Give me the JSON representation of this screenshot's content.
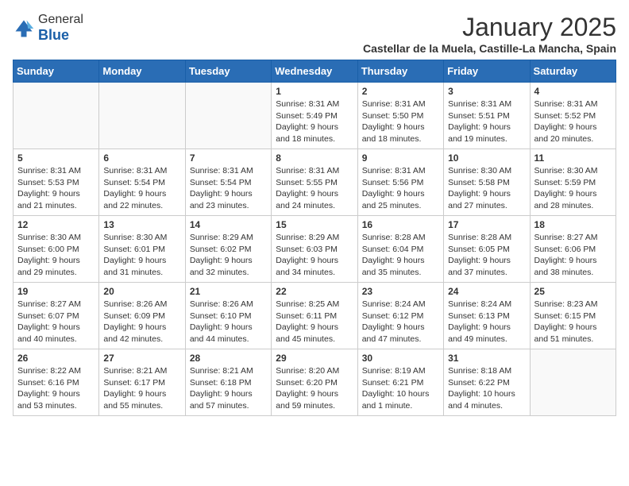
{
  "header": {
    "logo_general": "General",
    "logo_blue": "Blue",
    "title": "January 2025",
    "subtitle": "Castellar de la Muela, Castille-La Mancha, Spain"
  },
  "calendar": {
    "days_of_week": [
      "Sunday",
      "Monday",
      "Tuesday",
      "Wednesday",
      "Thursday",
      "Friday",
      "Saturday"
    ],
    "weeks": [
      [
        {
          "day": "",
          "info": ""
        },
        {
          "day": "",
          "info": ""
        },
        {
          "day": "",
          "info": ""
        },
        {
          "day": "1",
          "info": "Sunrise: 8:31 AM\nSunset: 5:49 PM\nDaylight: 9 hours and 18 minutes."
        },
        {
          "day": "2",
          "info": "Sunrise: 8:31 AM\nSunset: 5:50 PM\nDaylight: 9 hours and 18 minutes."
        },
        {
          "day": "3",
          "info": "Sunrise: 8:31 AM\nSunset: 5:51 PM\nDaylight: 9 hours and 19 minutes."
        },
        {
          "day": "4",
          "info": "Sunrise: 8:31 AM\nSunset: 5:52 PM\nDaylight: 9 hours and 20 minutes."
        }
      ],
      [
        {
          "day": "5",
          "info": "Sunrise: 8:31 AM\nSunset: 5:53 PM\nDaylight: 9 hours and 21 minutes."
        },
        {
          "day": "6",
          "info": "Sunrise: 8:31 AM\nSunset: 5:54 PM\nDaylight: 9 hours and 22 minutes."
        },
        {
          "day": "7",
          "info": "Sunrise: 8:31 AM\nSunset: 5:54 PM\nDaylight: 9 hours and 23 minutes."
        },
        {
          "day": "8",
          "info": "Sunrise: 8:31 AM\nSunset: 5:55 PM\nDaylight: 9 hours and 24 minutes."
        },
        {
          "day": "9",
          "info": "Sunrise: 8:31 AM\nSunset: 5:56 PM\nDaylight: 9 hours and 25 minutes."
        },
        {
          "day": "10",
          "info": "Sunrise: 8:30 AM\nSunset: 5:58 PM\nDaylight: 9 hours and 27 minutes."
        },
        {
          "day": "11",
          "info": "Sunrise: 8:30 AM\nSunset: 5:59 PM\nDaylight: 9 hours and 28 minutes."
        }
      ],
      [
        {
          "day": "12",
          "info": "Sunrise: 8:30 AM\nSunset: 6:00 PM\nDaylight: 9 hours and 29 minutes."
        },
        {
          "day": "13",
          "info": "Sunrise: 8:30 AM\nSunset: 6:01 PM\nDaylight: 9 hours and 31 minutes."
        },
        {
          "day": "14",
          "info": "Sunrise: 8:29 AM\nSunset: 6:02 PM\nDaylight: 9 hours and 32 minutes."
        },
        {
          "day": "15",
          "info": "Sunrise: 8:29 AM\nSunset: 6:03 PM\nDaylight: 9 hours and 34 minutes."
        },
        {
          "day": "16",
          "info": "Sunrise: 8:28 AM\nSunset: 6:04 PM\nDaylight: 9 hours and 35 minutes."
        },
        {
          "day": "17",
          "info": "Sunrise: 8:28 AM\nSunset: 6:05 PM\nDaylight: 9 hours and 37 minutes."
        },
        {
          "day": "18",
          "info": "Sunrise: 8:27 AM\nSunset: 6:06 PM\nDaylight: 9 hours and 38 minutes."
        }
      ],
      [
        {
          "day": "19",
          "info": "Sunrise: 8:27 AM\nSunset: 6:07 PM\nDaylight: 9 hours and 40 minutes."
        },
        {
          "day": "20",
          "info": "Sunrise: 8:26 AM\nSunset: 6:09 PM\nDaylight: 9 hours and 42 minutes."
        },
        {
          "day": "21",
          "info": "Sunrise: 8:26 AM\nSunset: 6:10 PM\nDaylight: 9 hours and 44 minutes."
        },
        {
          "day": "22",
          "info": "Sunrise: 8:25 AM\nSunset: 6:11 PM\nDaylight: 9 hours and 45 minutes."
        },
        {
          "day": "23",
          "info": "Sunrise: 8:24 AM\nSunset: 6:12 PM\nDaylight: 9 hours and 47 minutes."
        },
        {
          "day": "24",
          "info": "Sunrise: 8:24 AM\nSunset: 6:13 PM\nDaylight: 9 hours and 49 minutes."
        },
        {
          "day": "25",
          "info": "Sunrise: 8:23 AM\nSunset: 6:15 PM\nDaylight: 9 hours and 51 minutes."
        }
      ],
      [
        {
          "day": "26",
          "info": "Sunrise: 8:22 AM\nSunset: 6:16 PM\nDaylight: 9 hours and 53 minutes."
        },
        {
          "day": "27",
          "info": "Sunrise: 8:21 AM\nSunset: 6:17 PM\nDaylight: 9 hours and 55 minutes."
        },
        {
          "day": "28",
          "info": "Sunrise: 8:21 AM\nSunset: 6:18 PM\nDaylight: 9 hours and 57 minutes."
        },
        {
          "day": "29",
          "info": "Sunrise: 8:20 AM\nSunset: 6:20 PM\nDaylight: 9 hours and 59 minutes."
        },
        {
          "day": "30",
          "info": "Sunrise: 8:19 AM\nSunset: 6:21 PM\nDaylight: 10 hours and 1 minute."
        },
        {
          "day": "31",
          "info": "Sunrise: 8:18 AM\nSunset: 6:22 PM\nDaylight: 10 hours and 4 minutes."
        },
        {
          "day": "",
          "info": ""
        }
      ]
    ]
  }
}
